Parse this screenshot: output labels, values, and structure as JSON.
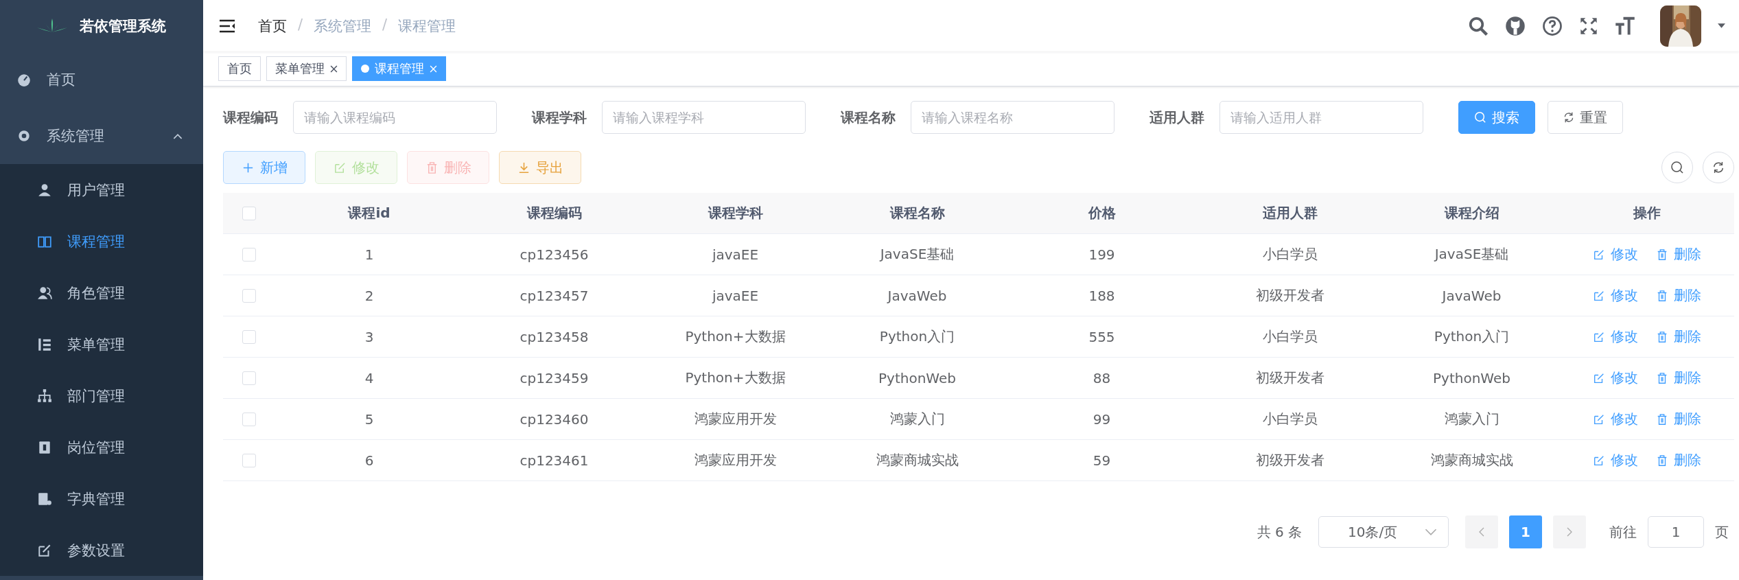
{
  "app": {
    "title": "若依管理系统"
  },
  "sidebar": {
    "items": [
      {
        "label": "首页",
        "selected": false
      },
      {
        "label": "系统管理",
        "selected": false,
        "expanded": true,
        "children": [
          {
            "label": "用户管理",
            "selected": false
          },
          {
            "label": "课程管理",
            "selected": true
          },
          {
            "label": "角色管理",
            "selected": false
          },
          {
            "label": "菜单管理",
            "selected": false
          },
          {
            "label": "部门管理",
            "selected": false
          },
          {
            "label": "岗位管理",
            "selected": false
          },
          {
            "label": "字典管理",
            "selected": false
          },
          {
            "label": "参数设置",
            "selected": false
          }
        ]
      }
    ]
  },
  "breadcrumb": {
    "separator": "/",
    "items": [
      "首页",
      "系统管理",
      "课程管理"
    ]
  },
  "tabs": [
    {
      "label": "首页",
      "selected": false,
      "closable": false
    },
    {
      "label": "菜单管理",
      "selected": false,
      "closable": true
    },
    {
      "label": "课程管理",
      "selected": true,
      "closable": true
    }
  ],
  "filters": [
    {
      "label": "课程编码",
      "placeholder": "请输入课程编码"
    },
    {
      "label": "课程学科",
      "placeholder": "请输入课程学科"
    },
    {
      "label": "课程名称",
      "placeholder": "请输入课程名称"
    },
    {
      "label": "适用人群",
      "placeholder": "请输入适用人群"
    }
  ],
  "filter_buttons": [
    {
      "label": "搜索",
      "kind": "primary"
    },
    {
      "label": "重置",
      "kind": "default"
    }
  ],
  "toolbar": [
    {
      "label": "新增",
      "kind": "add",
      "disabled": false
    },
    {
      "label": "修改",
      "kind": "edit",
      "disabled": true
    },
    {
      "label": "删除",
      "kind": "delete",
      "disabled": true
    },
    {
      "label": "导出",
      "kind": "export",
      "disabled": false
    }
  ],
  "table": {
    "all_checked": false,
    "columns": [
      "课程id",
      "课程编码",
      "课程学科",
      "课程名称",
      "价格",
      "适用人群",
      "课程介绍",
      "操作"
    ],
    "rows": [
      {
        "checked": false,
        "cells": [
          "1",
          "cp123456",
          "javaEE",
          "JavaSE基础",
          "199",
          "小白学员",
          "JavaSE基础"
        ],
        "actions": [
          "修改",
          "删除"
        ]
      },
      {
        "checked": false,
        "cells": [
          "2",
          "cp123457",
          "javaEE",
          "JavaWeb",
          "188",
          "初级开发者",
          "JavaWeb"
        ],
        "actions": [
          "修改",
          "删除"
        ]
      },
      {
        "checked": false,
        "cells": [
          "3",
          "cp123458",
          "Python+大数据",
          "Python入门",
          "555",
          "小白学员",
          "Python入门"
        ],
        "actions": [
          "修改",
          "删除"
        ]
      },
      {
        "checked": false,
        "cells": [
          "4",
          "cp123459",
          "Python+大数据",
          "PythonWeb",
          "88",
          "初级开发者",
          "PythonWeb"
        ],
        "actions": [
          "修改",
          "删除"
        ]
      },
      {
        "checked": false,
        "cells": [
          "5",
          "cp123460",
          "鸿蒙应用开发",
          "鸿蒙入门",
          "99",
          "小白学员",
          "鸿蒙入门"
        ],
        "actions": [
          "修改",
          "删除"
        ]
      },
      {
        "checked": false,
        "cells": [
          "6",
          "cp123461",
          "鸿蒙应用开发",
          "鸿蒙商城实战",
          "59",
          "初级开发者",
          "鸿蒙商城实战"
        ],
        "actions": [
          "修改",
          "删除"
        ]
      }
    ]
  },
  "pagination": {
    "total": "共 6 条",
    "page_size": "10条/页",
    "pages": [
      {
        "label": "1",
        "selected": true
      }
    ],
    "goto_label": "前往",
    "goto_value": "1",
    "goto_suffix": "页"
  }
}
